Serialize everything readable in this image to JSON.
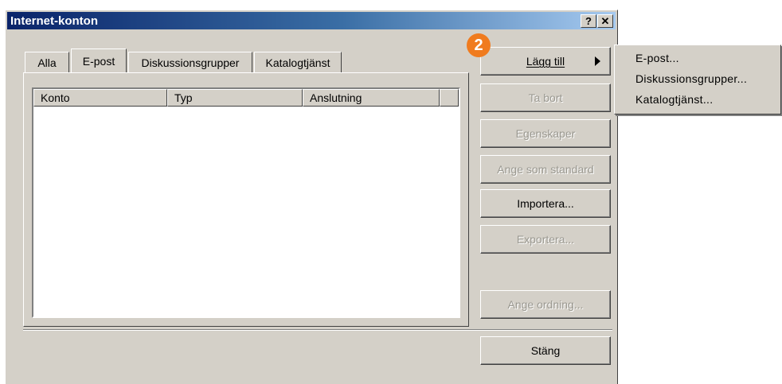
{
  "window": {
    "title": "Internet-konton",
    "help_label": "?",
    "close_label": "✕"
  },
  "tabs": [
    {
      "label": "Alla",
      "active": false
    },
    {
      "label": "E-post",
      "active": true
    },
    {
      "label": "Diskussionsgrupper",
      "active": false
    },
    {
      "label": "Katalogtjänst",
      "active": false
    }
  ],
  "list": {
    "columns": [
      "Konto",
      "Typ",
      "Anslutning"
    ],
    "rows": []
  },
  "buttons": {
    "add": "Lägg till",
    "remove": "Ta bort",
    "properties": "Egenskaper",
    "set_default": "Ange som standard",
    "import": "Importera...",
    "export": "Exportera...",
    "set_order": "Ange ordning...",
    "close": "Stäng"
  },
  "badge": "2",
  "submenu": {
    "items": [
      "E-post...",
      "Diskussionsgrupper...",
      "Katalogtjänst..."
    ]
  },
  "colors": {
    "dialog_bg": "#d4d0c8",
    "title_start": "#0a246a",
    "title_end": "#a6caf0",
    "badge": "#f07b1e"
  }
}
